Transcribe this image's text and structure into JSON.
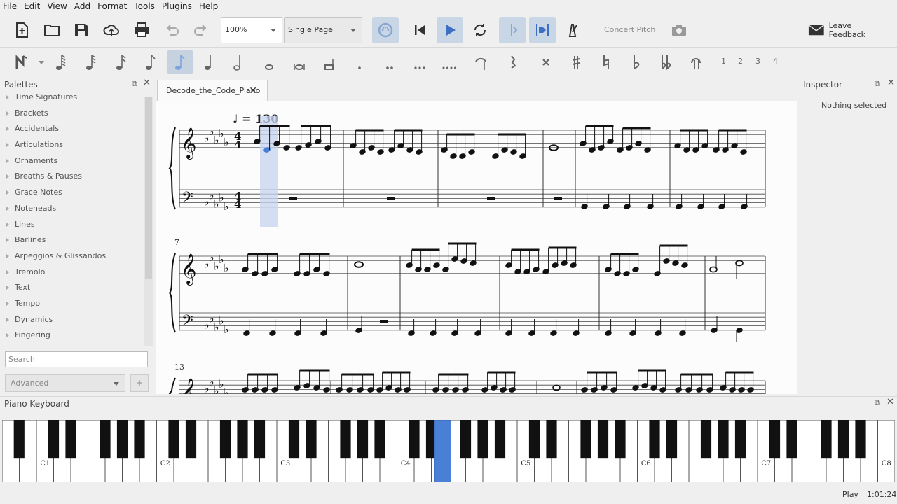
{
  "menu": [
    "File",
    "Edit",
    "View",
    "Add",
    "Format",
    "Tools",
    "Plugins",
    "Help"
  ],
  "toolbar": {
    "zoom_value": "100%",
    "view_mode": "Single Page",
    "concert_pitch_label": "Concert Pitch",
    "leave_feedback_label": "Leave Feedback"
  },
  "voices": [
    "1",
    "2",
    "3",
    "4"
  ],
  "palettes": {
    "title": "Palettes",
    "items": [
      "Time Signatures",
      "Brackets",
      "Accidentals",
      "Articulations",
      "Ornaments",
      "Breaths & Pauses",
      "Grace Notes",
      "Noteheads",
      "Lines",
      "Barlines",
      "Arpeggios & Glissandos",
      "Tremolo",
      "Text",
      "Tempo",
      "Dynamics",
      "Fingering"
    ],
    "search_placeholder": "Search",
    "advanced_label": "Advanced",
    "add_label": "+"
  },
  "score": {
    "tab_title": "Decode_the_Code_Piano",
    "tempo_text": "♩ = 130",
    "measure_numbers": [
      "7",
      "13"
    ]
  },
  "inspector": {
    "title": "Inspector",
    "empty_text": "Nothing selected"
  },
  "piano": {
    "title": "Piano Keyboard",
    "octave_labels": [
      "C1",
      "C2",
      "C3",
      "C4",
      "C5",
      "C6",
      "C7",
      "C8"
    ]
  },
  "status": {
    "state": "Play",
    "position": "1:01:240"
  },
  "colors": {
    "accent": "#4a7fd6",
    "selection": "#c5d4ef",
    "active_button": "#c9d6e6"
  }
}
